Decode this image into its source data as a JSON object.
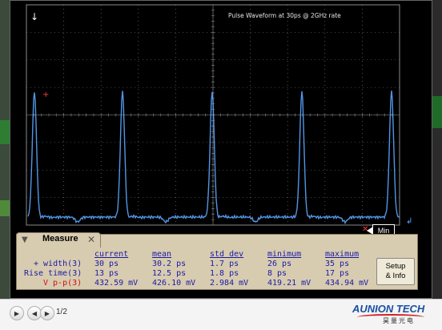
{
  "screen": {
    "title": "Pulse Waveform at 30ps @ 2GHz rate",
    "min_tag": "Min"
  },
  "chart_data": {
    "type": "line",
    "series": [
      {
        "values": [
          1
        ]
      }
    ],
    "peaks": 5
  },
  "measure": {
    "tab_label": "Measure",
    "headers": [
      "current",
      "mean",
      "std dev",
      "minimum",
      "maximum"
    ],
    "rows": [
      {
        "label": "+ width(3)",
        "current": "30 ps",
        "mean": "30.2 ps",
        "std": "1.7 ps",
        "min": "26 ps",
        "max": "35 ps"
      },
      {
        "label": "Rise time(3)",
        "current": "13 ps",
        "mean": "12.5 ps",
        "std": "1.8 ps",
        "min": "8 ps",
        "max": "17 ps"
      },
      {
        "label": "V p-p(3)",
        "current": "432.59 mV",
        "mean": "426.10 mV",
        "std": "2.984 mV",
        "min": "419.21 mV",
        "max": "434.94 mV"
      }
    ],
    "setup_line1": "Setup",
    "setup_line2": "& Info"
  },
  "viewer": {
    "page_info": "1/2"
  },
  "logo": {
    "name": "AUNION TECH",
    "cn": "昊量光电"
  },
  "colors": {
    "trace": "#5aa6ff",
    "grid": "#8a8a8a",
    "red": "#d01010",
    "blue": "#1a1aa6"
  }
}
